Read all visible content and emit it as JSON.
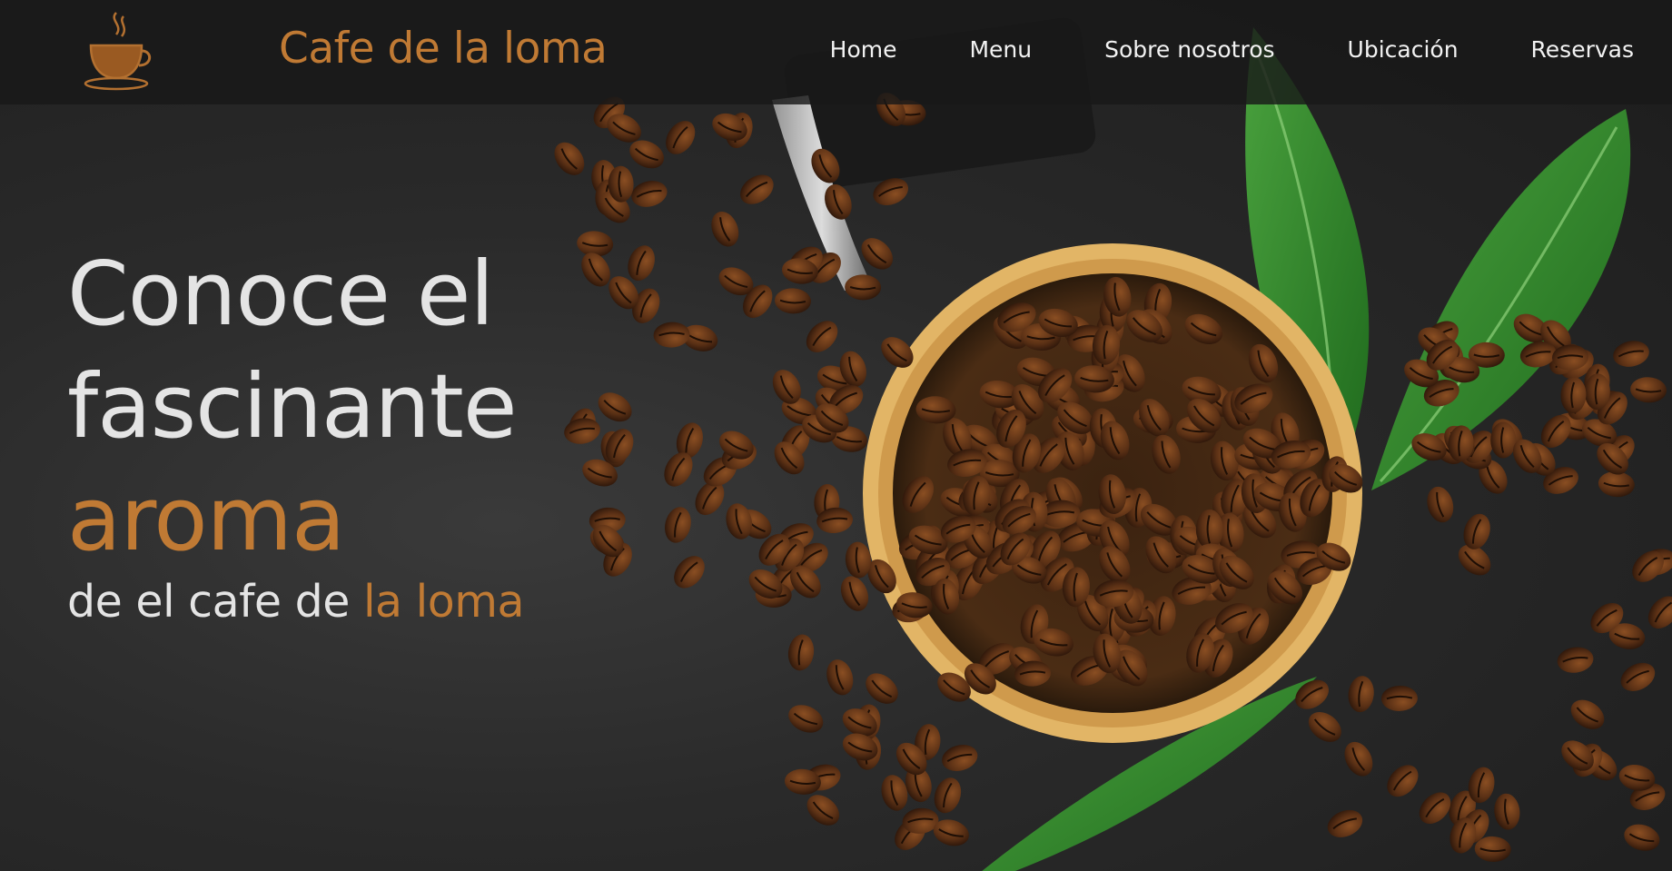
{
  "brand": {
    "name": "Cafe de la loma",
    "logo_icon": "coffee-cup-icon"
  },
  "nav": {
    "items": [
      {
        "label": "Home"
      },
      {
        "label": "Menu"
      },
      {
        "label": "Sobre nosotros"
      },
      {
        "label": "Ubicación"
      },
      {
        "label": "Reservas"
      }
    ]
  },
  "hero": {
    "line1": "Conoce el",
    "line2": "fascinante",
    "line3": "aroma",
    "sub_prefix": "de el cafe de ",
    "sub_accent": "la loma",
    "image": "coffee-beans-bowl-leaves-image"
  },
  "colors": {
    "accent": "#c07a34",
    "text": "#e4e4e4",
    "nav_text": "#f2f2f2",
    "navbar_bg": "#191919",
    "background": "#2a2a2a",
    "leaf": "#2f8a2a",
    "bowl": "#d9a85a"
  }
}
